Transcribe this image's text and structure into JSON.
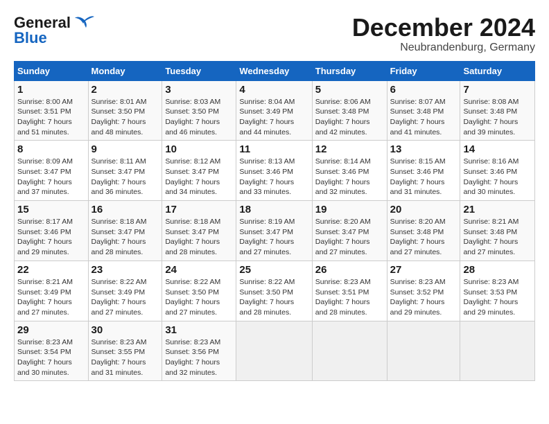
{
  "logo": {
    "general": "General",
    "blue": "Blue"
  },
  "title": "December 2024",
  "subtitle": "Neubrandenburg, Germany",
  "days_of_week": [
    "Sunday",
    "Monday",
    "Tuesday",
    "Wednesday",
    "Thursday",
    "Friday",
    "Saturday"
  ],
  "weeks": [
    [
      {
        "day": "1",
        "sunrise": "8:00 AM",
        "sunset": "3:51 PM",
        "daylight": "7 hours and 51 minutes."
      },
      {
        "day": "2",
        "sunrise": "8:01 AM",
        "sunset": "3:50 PM",
        "daylight": "7 hours and 48 minutes."
      },
      {
        "day": "3",
        "sunrise": "8:03 AM",
        "sunset": "3:50 PM",
        "daylight": "7 hours and 46 minutes."
      },
      {
        "day": "4",
        "sunrise": "8:04 AM",
        "sunset": "3:49 PM",
        "daylight": "7 hours and 44 minutes."
      },
      {
        "day": "5",
        "sunrise": "8:06 AM",
        "sunset": "3:48 PM",
        "daylight": "7 hours and 42 minutes."
      },
      {
        "day": "6",
        "sunrise": "8:07 AM",
        "sunset": "3:48 PM",
        "daylight": "7 hours and 41 minutes."
      },
      {
        "day": "7",
        "sunrise": "8:08 AM",
        "sunset": "3:48 PM",
        "daylight": "7 hours and 39 minutes."
      }
    ],
    [
      {
        "day": "8",
        "sunrise": "8:09 AM",
        "sunset": "3:47 PM",
        "daylight": "7 hours and 37 minutes."
      },
      {
        "day": "9",
        "sunrise": "8:11 AM",
        "sunset": "3:47 PM",
        "daylight": "7 hours and 36 minutes."
      },
      {
        "day": "10",
        "sunrise": "8:12 AM",
        "sunset": "3:47 PM",
        "daylight": "7 hours and 34 minutes."
      },
      {
        "day": "11",
        "sunrise": "8:13 AM",
        "sunset": "3:46 PM",
        "daylight": "7 hours and 33 minutes."
      },
      {
        "day": "12",
        "sunrise": "8:14 AM",
        "sunset": "3:46 PM",
        "daylight": "7 hours and 32 minutes."
      },
      {
        "day": "13",
        "sunrise": "8:15 AM",
        "sunset": "3:46 PM",
        "daylight": "7 hours and 31 minutes."
      },
      {
        "day": "14",
        "sunrise": "8:16 AM",
        "sunset": "3:46 PM",
        "daylight": "7 hours and 30 minutes."
      }
    ],
    [
      {
        "day": "15",
        "sunrise": "8:17 AM",
        "sunset": "3:46 PM",
        "daylight": "7 hours and 29 minutes."
      },
      {
        "day": "16",
        "sunrise": "8:18 AM",
        "sunset": "3:47 PM",
        "daylight": "7 hours and 28 minutes."
      },
      {
        "day": "17",
        "sunrise": "8:18 AM",
        "sunset": "3:47 PM",
        "daylight": "7 hours and 28 minutes."
      },
      {
        "day": "18",
        "sunrise": "8:19 AM",
        "sunset": "3:47 PM",
        "daylight": "7 hours and 27 minutes."
      },
      {
        "day": "19",
        "sunrise": "8:20 AM",
        "sunset": "3:47 PM",
        "daylight": "7 hours and 27 minutes."
      },
      {
        "day": "20",
        "sunrise": "8:20 AM",
        "sunset": "3:48 PM",
        "daylight": "7 hours and 27 minutes."
      },
      {
        "day": "21",
        "sunrise": "8:21 AM",
        "sunset": "3:48 PM",
        "daylight": "7 hours and 27 minutes."
      }
    ],
    [
      {
        "day": "22",
        "sunrise": "8:21 AM",
        "sunset": "3:49 PM",
        "daylight": "7 hours and 27 minutes."
      },
      {
        "day": "23",
        "sunrise": "8:22 AM",
        "sunset": "3:49 PM",
        "daylight": "7 hours and 27 minutes."
      },
      {
        "day": "24",
        "sunrise": "8:22 AM",
        "sunset": "3:50 PM",
        "daylight": "7 hours and 27 minutes."
      },
      {
        "day": "25",
        "sunrise": "8:22 AM",
        "sunset": "3:50 PM",
        "daylight": "7 hours and 28 minutes."
      },
      {
        "day": "26",
        "sunrise": "8:23 AM",
        "sunset": "3:51 PM",
        "daylight": "7 hours and 28 minutes."
      },
      {
        "day": "27",
        "sunrise": "8:23 AM",
        "sunset": "3:52 PM",
        "daylight": "7 hours and 29 minutes."
      },
      {
        "day": "28",
        "sunrise": "8:23 AM",
        "sunset": "3:53 PM",
        "daylight": "7 hours and 29 minutes."
      }
    ],
    [
      {
        "day": "29",
        "sunrise": "8:23 AM",
        "sunset": "3:54 PM",
        "daylight": "7 hours and 30 minutes."
      },
      {
        "day": "30",
        "sunrise": "8:23 AM",
        "sunset": "3:55 PM",
        "daylight": "7 hours and 31 minutes."
      },
      {
        "day": "31",
        "sunrise": "8:23 AM",
        "sunset": "3:56 PM",
        "daylight": "7 hours and 32 minutes."
      },
      null,
      null,
      null,
      null
    ]
  ],
  "labels": {
    "sunrise": "Sunrise:",
    "sunset": "Sunset:",
    "daylight": "Daylight:"
  }
}
